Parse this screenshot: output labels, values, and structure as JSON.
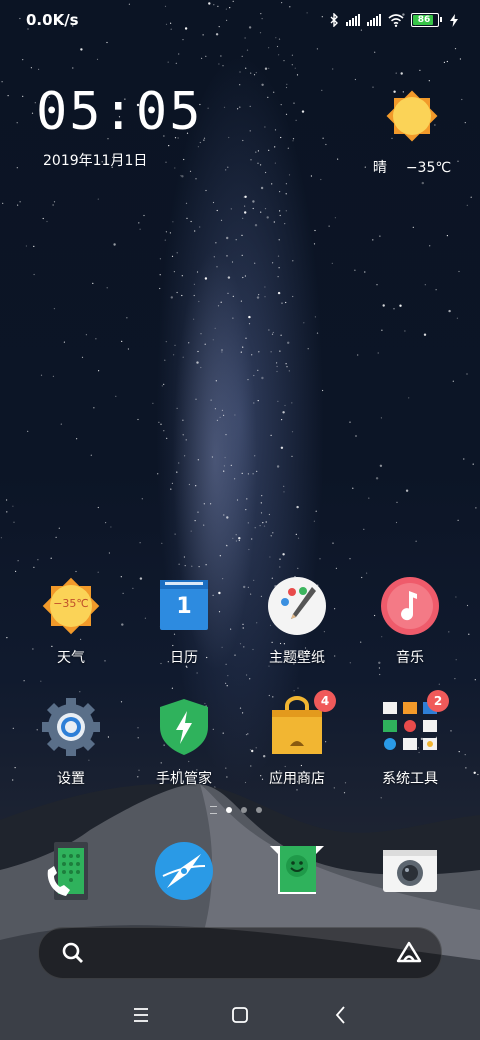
{
  "status_bar": {
    "network_speed": "0.0K/s",
    "battery_level": "86"
  },
  "clock_widget": {
    "time": "05:05",
    "date": "2019年11月1日"
  },
  "weather_widget": {
    "condition": "晴",
    "temperature": "−35℃"
  },
  "home_apps": [
    {
      "label": "天气",
      "icon_temp": "−35℃",
      "icon": "weather-sun-icon"
    },
    {
      "label": "日历",
      "icon_day": "1",
      "icon": "calendar-icon"
    },
    {
      "label": "主题壁纸",
      "icon": "palette-icon"
    },
    {
      "label": "音乐",
      "icon": "music-note-icon"
    },
    {
      "label": "设置",
      "icon": "gear-icon"
    },
    {
      "label": "手机管家",
      "icon": "shield-bolt-icon"
    },
    {
      "label": "应用商店",
      "badge": "4",
      "icon": "shopping-bag-icon"
    },
    {
      "label": "系统工具",
      "badge": "2",
      "icon": "folder-icon"
    }
  ],
  "dock": [
    {
      "icon": "phone-icon"
    },
    {
      "icon": "browser-compass-icon"
    },
    {
      "icon": "messages-icon"
    },
    {
      "icon": "camera-icon"
    }
  ],
  "page_indicator": {
    "pages": 3,
    "active": 1
  },
  "colors": {
    "battery_fill": "#37c447",
    "badge": "#f05a5a",
    "calendar_blue": "#2d8be0",
    "security_green": "#2fb25c",
    "store_yellow": "#f2b632",
    "music_pink": "#ef5b6b",
    "browser_blue": "#2a9ae6"
  }
}
